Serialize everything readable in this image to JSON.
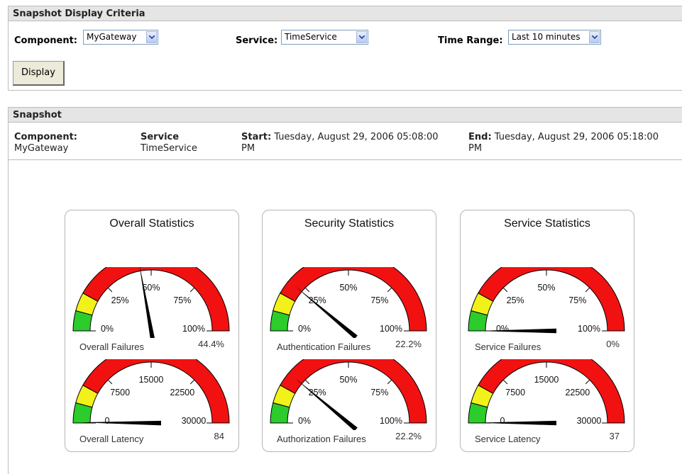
{
  "criteria": {
    "title": "Snapshot Display Criteria",
    "component_label": "Component:",
    "component_value": "MyGateway",
    "service_label": "Service:",
    "service_value": "TimeService",
    "timerange_label": "Time Range:",
    "timerange_value": "Last 10 minutes",
    "display_button": "Display"
  },
  "snapshot": {
    "title": "Snapshot",
    "component_label": "Component:",
    "component_value": "MyGateway",
    "service_label": "Service",
    "service_value": "TimeService",
    "start_label": "Start:",
    "start_value_line1": "Tuesday, August 29, 2006 05:08:00",
    "start_value_line2": "PM",
    "end_label": "End:",
    "end_value_line1": "Tuesday, August 29, 2006 05:18:00",
    "end_value_line2": "PM"
  },
  "panels": [
    {
      "title": "Overall Statistics",
      "gauges": [
        {
          "label": "Overall Failures",
          "value_text": "44.4%",
          "min": 0,
          "max": 100,
          "value": 44.4,
          "ticks": [
            "0%",
            "25%",
            "50%",
            "75%",
            "100%"
          ]
        },
        {
          "label": "Overall Latency",
          "value_text": "84",
          "min": 0,
          "max": 30000,
          "value": 84,
          "ticks": [
            "0",
            "7500",
            "15000",
            "22500",
            "30000"
          ]
        }
      ]
    },
    {
      "title": "Security Statistics",
      "gauges": [
        {
          "label": "Authentication Failures",
          "value_text": "22.2%",
          "min": 0,
          "max": 100,
          "value": 22.2,
          "ticks": [
            "0%",
            "25%",
            "50%",
            "75%",
            "100%"
          ]
        },
        {
          "label": "Authorization Failures",
          "value_text": "22.2%",
          "min": 0,
          "max": 100,
          "value": 22.2,
          "ticks": [
            "0%",
            "25%",
            "50%",
            "75%",
            "100%"
          ]
        }
      ]
    },
    {
      "title": "Service Statistics",
      "gauges": [
        {
          "label": "Service Failures",
          "value_text": "0%",
          "min": 0,
          "max": 100,
          "value": 0,
          "ticks": [
            "0%",
            "25%",
            "50%",
            "75%",
            "100%"
          ]
        },
        {
          "label": "Service Latency",
          "value_text": "37",
          "min": 0,
          "max": 30000,
          "value": 37,
          "ticks": [
            "0",
            "7500",
            "15000",
            "22500",
            "30000"
          ]
        }
      ]
    }
  ],
  "colors": {
    "green": "#2bcc2b",
    "yellow": "#f2f21a",
    "red": "#f21111",
    "needle": "#000000"
  }
}
